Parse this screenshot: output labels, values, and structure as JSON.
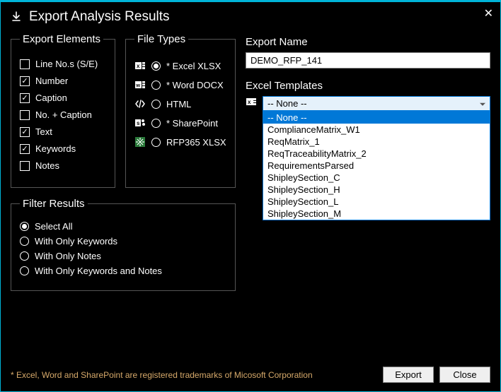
{
  "window": {
    "title": "Export Analysis Results"
  },
  "exportElements": {
    "legend": "Export Elements",
    "items": [
      {
        "label": "Line No.s (S/E)",
        "checked": false
      },
      {
        "label": "Number",
        "checked": true
      },
      {
        "label": "Caption",
        "checked": true
      },
      {
        "label": "No. + Caption",
        "checked": false
      },
      {
        "label": "Text",
        "checked": true
      },
      {
        "label": "Keywords",
        "checked": true
      },
      {
        "label": "Notes",
        "checked": false
      }
    ]
  },
  "fileTypes": {
    "legend": "File Types",
    "items": [
      {
        "label": "* Excel XLSX",
        "icon": "excel-icon",
        "checked": true
      },
      {
        "label": "* Word DOCX",
        "icon": "word-icon",
        "checked": false
      },
      {
        "label": "HTML",
        "icon": "code-icon",
        "checked": false
      },
      {
        "label": "* SharePoint",
        "icon": "sharepoint-icon",
        "checked": false
      },
      {
        "label": "RFP365 XLSX",
        "icon": "rfp365-icon",
        "checked": false
      }
    ]
  },
  "exportName": {
    "label": "Export Name",
    "value": "DEMO_RFP_141"
  },
  "excelTemplates": {
    "label": "Excel Templates",
    "icon": "excel-icon",
    "selected": "-- None --",
    "options": [
      "-- None --",
      "ComplianceMatrix_W1",
      "ReqMatrix_1",
      "ReqTraceabilityMatrix_2",
      "RequirementsParsed",
      "ShipleySection_C",
      "ShipleySection_H",
      "ShipleySection_L",
      "ShipleySection_M"
    ],
    "highlightIndex": 0
  },
  "filterResults": {
    "legend": "Filter Results",
    "items": [
      {
        "label": "Select All",
        "checked": true
      },
      {
        "label": "With Only Keywords",
        "checked": false
      },
      {
        "label": "With Only Notes",
        "checked": false
      },
      {
        "label": "With Only Keywords and Notes",
        "checked": false
      }
    ]
  },
  "footnote": "* Excel, Word and SharePoint are registered trademarks of Micosoft Corporation",
  "buttons": {
    "export": "Export",
    "close": "Close"
  }
}
